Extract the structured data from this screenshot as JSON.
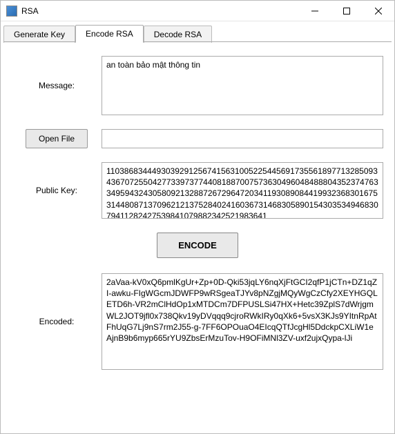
{
  "window": {
    "title": "RSA"
  },
  "tabs": {
    "generate": "Generate Key",
    "encode": "Encode RSA",
    "decode": "Decode RSA"
  },
  "labels": {
    "message": "Message:",
    "public_key": "Public Key:",
    "encoded": "Encoded:",
    "open_file": "Open File",
    "encode_btn": "ENCODE"
  },
  "values": {
    "message": "an toàn bảo mật thông tin",
    "file_path": "",
    "public_key": "1103868344493039291256741563100522544569173556189771328509343670725504277339737744081887007573630496048488804352374763349594324305809213288726729647203411930890844199323683016753144808713709621213752840241603673146830589015430353494683079411282427539841079882342521983641",
    "encoded": "2aVaa-kV0xQ6pmlKgUr+Zp+0D-Qki53jqLY6nqXjFtGCI2qfP1jCTn+DZ1qZI-awku-FIgWGcmJDWFP9wRSgeaTJYv8pNZgjMQyWgCzCfy2XEYHGQLETD6h-VR2mClHdOp1xMTDCm7DFPUSLSi47HX+Hetc39ZplS7dWrjgmWL2JOT9jfl0x738Qkv19yDVqqq9cjroRWkIRy0qXk6+5vsX3KJs9YItnRpAtFhUqG7Lj9nS7rm2J55-g-7FF6OPOuaO4EIcqQTfJcgHl5DdckpCXLiW1eAjnB9b6myp665rYU9ZbsErMzuTov-H9OFiMNl3ZV-uxf2ujxQypa-lJi"
  }
}
